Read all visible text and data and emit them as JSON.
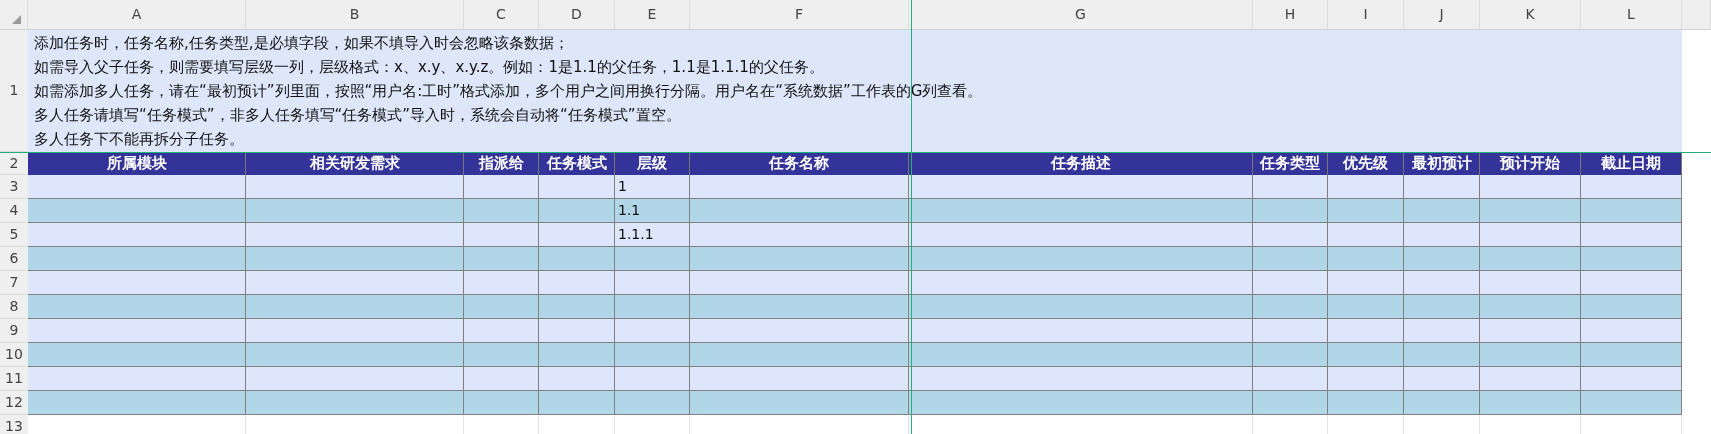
{
  "column_letters": [
    "A",
    "B",
    "C",
    "D",
    "E",
    "F",
    "G",
    "H",
    "I",
    "J",
    "K",
    "L"
  ],
  "notes": {
    "row_number": "1",
    "lines": [
      "添加任务时，任务名称,任务类型,是必填字段，如果不填导入时会忽略该条数据；",
      "如需导入父子任务，则需要填写层级一列，层级格式：x、x.y、x.y.z。例如：1是1.1的父任务，1.1是1.1.1的父任务。",
      "如需添加多人任务，请在“最初预计”列里面，按照“用户名:工时”格式添加，多个用户之间用换行分隔。用户名在“系统数据”工作表的G列查看。",
      "多人任务请填写“任务模式”，非多人任务填写“任务模式”导入时，系统会自动将“任务模式”置空。",
      "多人任务下不能再拆分子任务。"
    ]
  },
  "header": {
    "row_number": "2",
    "labels": [
      "所属模块",
      "相关研发需求",
      "指派给",
      "任务模式",
      "层级",
      "任务名称",
      "任务描述",
      "任务类型",
      "优先级",
      "最初预计",
      "预计开始",
      "截止日期"
    ]
  },
  "rows": [
    {
      "row_number": "3",
      "kind": "data",
      "shaded": false,
      "level_value": "1"
    },
    {
      "row_number": "4",
      "kind": "data",
      "shaded": true,
      "level_value": "1.1"
    },
    {
      "row_number": "5",
      "kind": "data",
      "shaded": false,
      "level_value": "1.1.1"
    },
    {
      "row_number": "6",
      "kind": "data",
      "shaded": true
    },
    {
      "row_number": "7",
      "kind": "data",
      "shaded": false
    },
    {
      "row_number": "8",
      "kind": "data",
      "shaded": true
    },
    {
      "row_number": "9",
      "kind": "data",
      "shaded": false
    },
    {
      "row_number": "10",
      "kind": "data",
      "shaded": true
    },
    {
      "row_number": "11",
      "kind": "data",
      "shaded": false
    },
    {
      "row_number": "12",
      "kind": "data",
      "shaded": true
    },
    {
      "row_number": "13",
      "kind": "empty"
    }
  ]
}
